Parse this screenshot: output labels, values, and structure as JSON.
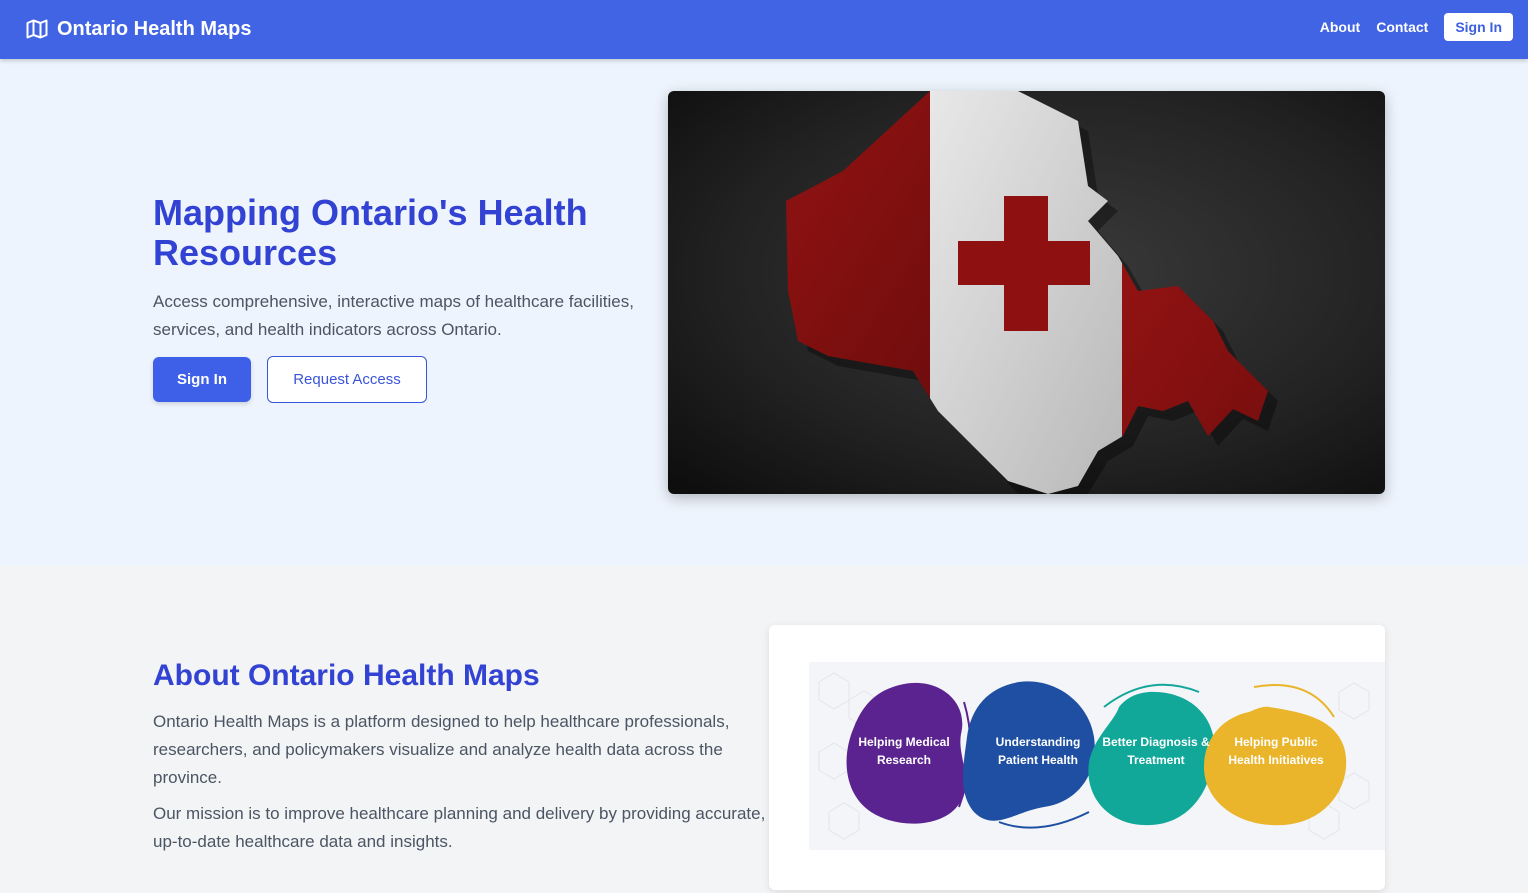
{
  "header": {
    "brand": "Ontario Health Maps",
    "brand_icon": "map-icon",
    "nav": {
      "about": "About",
      "contact": "Contact",
      "sign_in": "Sign In"
    }
  },
  "hero": {
    "title": "Mapping Ontario's Health Resources",
    "description": "Access comprehensive, interactive maps of healthcare facilities, services, and health indicators across Ontario.",
    "primary_button": "Sign In",
    "secondary_button": "Request Access"
  },
  "about": {
    "title": "About Ontario Health Maps",
    "paragraph1": "Ontario Health Maps is a platform designed to help healthcare professionals, researchers, and policymakers visualize and analyze health data across the province.",
    "paragraph2": "Our mission is to improve healthcare planning and delivery by providing accurate, up-to-date healthcare data and insights.",
    "infographic": [
      {
        "label": "Helping Medical Research",
        "color": "#5b2390"
      },
      {
        "label": "Understanding Patient Health",
        "color": "#1e4fa3"
      },
      {
        "label": "Better Diagnosis & Treatment",
        "color": "#11a89a"
      },
      {
        "label": "Helping Public Health Initiatives",
        "color": "#eab52a"
      }
    ]
  },
  "colors": {
    "header_bg": "#4064e3",
    "accent": "#3242d2",
    "primary_button": "#3e5fe8",
    "hero_bg": "#eef4fd"
  }
}
